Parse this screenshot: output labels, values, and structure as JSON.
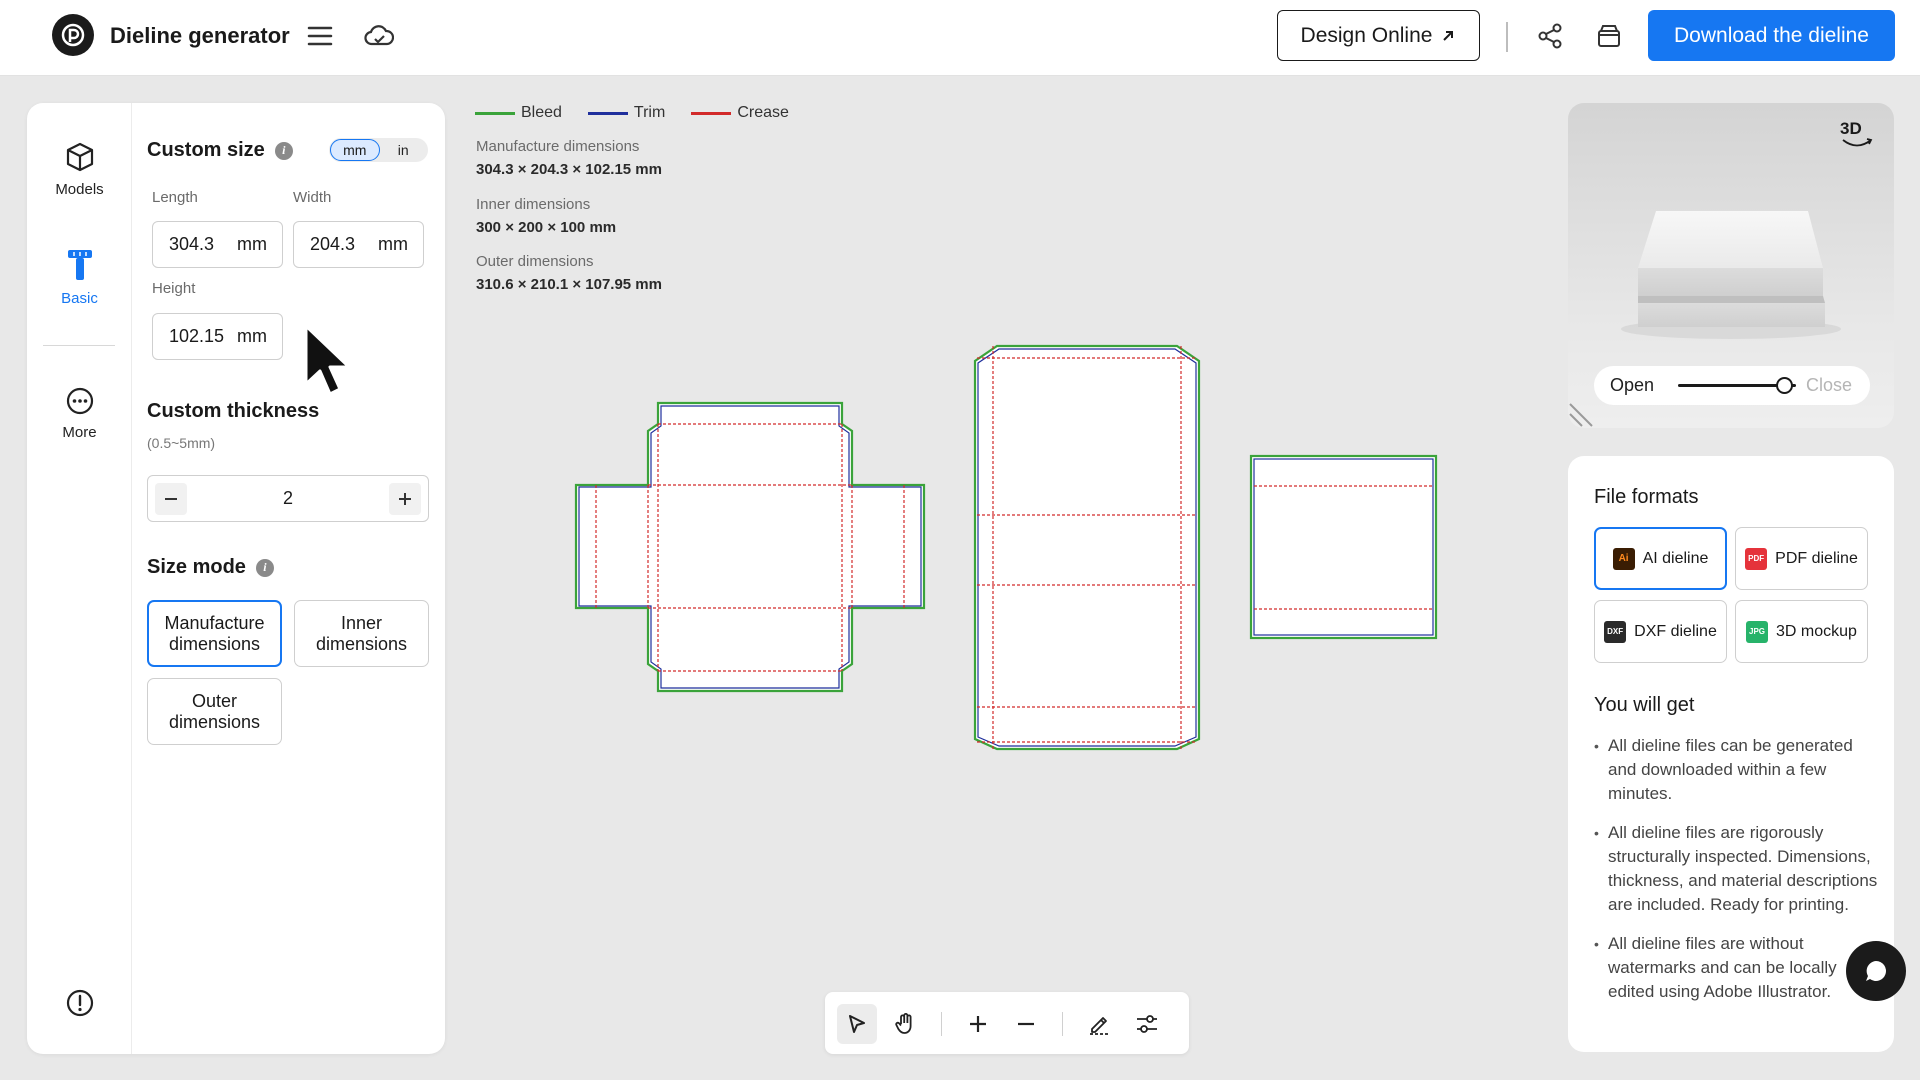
{
  "header": {
    "app_title": "Dieline generator",
    "design_online_label": "Design Online",
    "download_label": "Download the dieline"
  },
  "rail": {
    "items": [
      {
        "label": "Models",
        "icon": "cube-icon"
      },
      {
        "label": "Basic",
        "icon": "ruler-icon"
      },
      {
        "label": "More",
        "icon": "more-icon"
      }
    ]
  },
  "custom_size": {
    "title": "Custom size",
    "units": [
      "mm",
      "in"
    ],
    "selected_unit": "mm",
    "length_label": "Length",
    "length_value": "304.3",
    "width_label": "Width",
    "width_value": "204.3",
    "height_label": "Height",
    "height_value": "102.15",
    "unit_suffix": "mm"
  },
  "custom_thickness": {
    "title": "Custom thickness",
    "range_hint": "(0.5~5mm)",
    "value": "2"
  },
  "size_mode": {
    "title": "Size mode",
    "options": [
      "Manufacture dimensions",
      "Inner dimensions",
      "Outer dimensions"
    ],
    "selected": "Manufacture dimensions"
  },
  "legend": [
    {
      "label": "Bleed",
      "color": "#3aa33a"
    },
    {
      "label": "Trim",
      "color": "#1f2f9c"
    },
    {
      "label": "Crease",
      "color": "#d22a2a"
    }
  ],
  "dimensions": {
    "manufacture_label": "Manufacture dimensions",
    "manufacture_value": "304.3 × 204.3 × 102.15 mm",
    "inner_label": "Inner dimensions",
    "inner_value": "300 × 200 × 100 mm",
    "outer_label": "Outer dimensions",
    "outer_value": "310.6 × 210.1 × 107.95 mm"
  },
  "preview": {
    "badge": "3D",
    "open_label": "Open",
    "close_label": "Close",
    "open_close_level": 0.9
  },
  "file_formats": {
    "title": "File formats",
    "items": [
      {
        "label": "AI dieline",
        "badge": "Ai",
        "color": "#3a1d03",
        "text": "#ff8a1e"
      },
      {
        "label": "PDF dieline",
        "badge": "PDF",
        "color": "#e5333b",
        "text": "#ffffff"
      },
      {
        "label": "DXF dieline",
        "badge": "DXF",
        "color": "#2a2a2a",
        "text": "#ffffff"
      },
      {
        "label": "3D mockup",
        "badge": "JPG",
        "color": "#27b36a",
        "text": "#ffffff"
      }
    ],
    "selected": "AI dieline"
  },
  "you_will_get": {
    "title": "You will get",
    "items": [
      "All dieline files can be generated and downloaded within a few minutes.",
      "All dieline files are rigorously structurally inspected. Dimensions, thickness, and material descriptions are included. Ready for printing.",
      "All dieline files are without watermarks and can be locally edited using Adobe Illustrator."
    ]
  },
  "colors": {
    "accent": "#1677f2",
    "bleed": "#3aa33a",
    "trim": "#1f2f9c",
    "crease": "#d22a2a"
  }
}
